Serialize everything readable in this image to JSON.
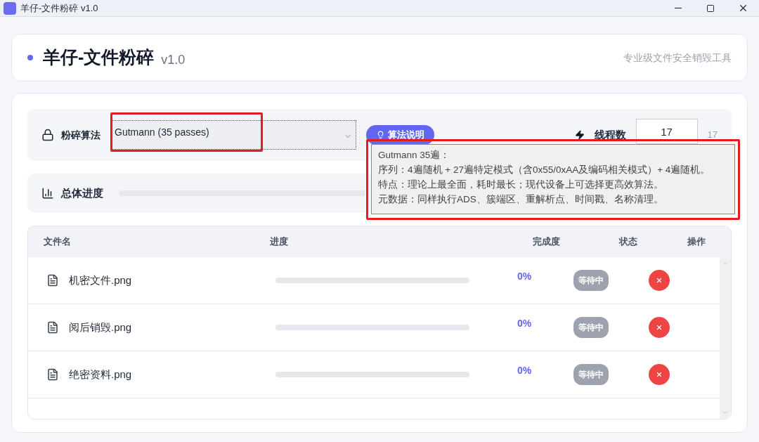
{
  "window": {
    "title": "羊仔-文件粉碎 v1.0"
  },
  "header": {
    "title": "羊仔-文件粉碎",
    "version": "v1.0",
    "subtitle": "专业级文件安全销毁工具"
  },
  "settings": {
    "algorithm_label": "粉碎算法",
    "algorithm_value": "Gutmann (35 passes)",
    "info_button": "算法说明",
    "threads_label": "线程数",
    "threads_value": "17",
    "threads_reading": "17"
  },
  "progress": {
    "label": "总体进度",
    "level": 0
  },
  "tooltip": {
    "lines": [
      "Gutmann 35遍：",
      "序列：4遍随机 + 27遍特定模式（含0x55/0xAA及编码相关模式）+ 4遍随机。",
      "特点：理论上最全面，耗时最长；现代设备上可选择更高效算法。",
      "元数据：同样执行ADS、簇端区、重解析点、时间戳、名称清理。"
    ]
  },
  "table": {
    "columns": [
      "文件名",
      "进度",
      "完成度",
      "状态",
      "操作"
    ],
    "rows": [
      {
        "name": "机密文件.png",
        "level": 0,
        "percent": "0%",
        "status": "等待中"
      },
      {
        "name": "阅后销毁.png",
        "level": 0,
        "percent": "0%",
        "status": "等待中"
      },
      {
        "name": "绝密资料.png",
        "level": 0,
        "percent": "0%",
        "status": "等待中"
      }
    ]
  }
}
